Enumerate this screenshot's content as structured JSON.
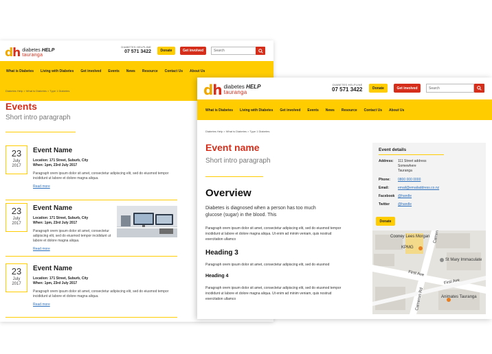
{
  "brand": {
    "name": "diabetes",
    "name_em": "HELP",
    "region": "tauranga",
    "mark_d": "d",
    "mark_h": "h"
  },
  "header": {
    "helpline_label": "DIABETES HELPLINE",
    "helpline_number": "07 571 3422",
    "donate_label": "Donate",
    "get_involved_label": "Get involved",
    "search_placeholder": "Search"
  },
  "nav": [
    "What is Diabetes",
    "Living with Diabetes",
    "Get involved",
    "Events",
    "News",
    "Resource",
    "Contact Us",
    "About Us"
  ],
  "events_page": {
    "breadcrumb": [
      "Diabetes Help",
      "What is Diabetes",
      "Type 1 Diabetes"
    ],
    "title": "Events",
    "intro": "Short intro paragraph",
    "events": [
      {
        "day": "23",
        "month": "July",
        "year": "2017",
        "name": "Event Name",
        "location": "Location: 171 Street, Suburb, City",
        "when": "When: 1pm, 23rd July 2017",
        "body": "Paragraph orem ipsum dolor sit amet, consectetur adipiscing elit, sed do eiusmod tempor incididunt ut labore et dolore magna aliqua.",
        "read_more": "Read more",
        "has_image": false
      },
      {
        "day": "23",
        "month": "July",
        "year": "2017",
        "name": "Event Name",
        "location": "Location: 171 Street, Suburb, City",
        "when": "When: 1pm, 23rd July 2017",
        "body": "Paragraph orem ipsum dolor sit amet, consectetur adipiscing elit, sed do eiusmod tempor incididunt ut labore et dolore magna aliqua.",
        "read_more": "Read more",
        "has_image": true
      },
      {
        "day": "23",
        "month": "July",
        "year": "2017",
        "name": "Event Name",
        "location": "Location: 171 Street, Suburb, City",
        "when": "When: 1pm, 23rd July 2017",
        "body": "Paragraph orem ipsum dolor sit amet, consectetur adipiscing elit, sed do eiusmod tempor incididunt ut labore et dolore magna aliqua.",
        "read_more": "Read more",
        "has_image": false
      }
    ]
  },
  "event_page": {
    "breadcrumb": [
      "Diabetes Help",
      "What is Diabetes",
      "Type 1 Diabetes"
    ],
    "title": "Event name",
    "intro": "Short intro paragraph",
    "overview_heading": "Overview",
    "lead": "Diabetes is diagnosed when a person has too much glucose (sugar) in the blood. This",
    "para1": "Paragraph orem ipsum dolor sit amet, consectetur adipiscing elit, sed do eiusmod tempor incididunt ut labore et dolore magna aliqua. Ut enim ad minim veniam, quis nostrud exercitation ullamco",
    "heading3": "Heading 3",
    "para2": "Paragraph orem ipsum dolor sit amet, consectetur adipiscing elit, sed do eiusmod",
    "heading4": "Heading 4",
    "para3": "Paragraph orem ipsum dolor sit amet, consectetur adipiscing elit, sed do eiusmod tempor incididunt ut labore et dolore magna aliqua. Ut enim ad minim veniam, quis nostrud exercitation ullamco",
    "details": {
      "title": "Event details",
      "address_label": "Address:",
      "address": [
        "111 Street address",
        "Somewhere",
        "Tauranga"
      ],
      "phone_label": "Phone:",
      "phone": "0800 000 0000",
      "email_label": "Email:",
      "email": "email@emailaddress.co.nz",
      "facebook_label": "Facebook",
      "facebook": "@handle",
      "twitter_label": "Twitter",
      "twitter": "@handle",
      "donate_label": "Donate"
    },
    "map": {
      "labels": [
        "Cooney Lees Morgan",
        "KPMG",
        "Cameron Rd",
        "St Mary Immaculate",
        "First Ave",
        "First Ave",
        "Cameron Rd",
        "Animates Tauranga"
      ]
    }
  },
  "colors": {
    "brand_yellow": "#ffcc00",
    "brand_red": "#d52e1b",
    "link_blue": "#2a6ebb"
  }
}
